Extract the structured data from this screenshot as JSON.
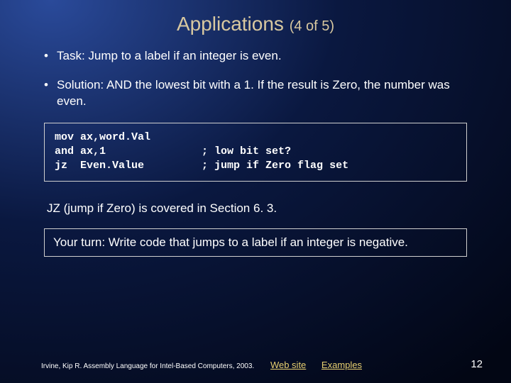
{
  "title": {
    "main": "Applications",
    "sub": "(4 of 5)"
  },
  "bullets": [
    "Task: Jump to a label if an integer is even.",
    "Solution: AND the lowest bit with a 1. If the result is Zero, the number was even."
  ],
  "code": "mov ax,word.Val\nand ax,1               ; low bit set?\njz  Even.Value         ; jump if Zero flag set",
  "note": "JZ (jump if Zero) is covered in Section 6. 3.",
  "yourturn": "Your turn: Write code that jumps to a label if an integer is negative.",
  "footer": {
    "credit": "Irvine, Kip R. Assembly Language for Intel-Based Computers, 2003.",
    "link1": "Web site",
    "link2": "Examples",
    "pagenum": "12"
  }
}
